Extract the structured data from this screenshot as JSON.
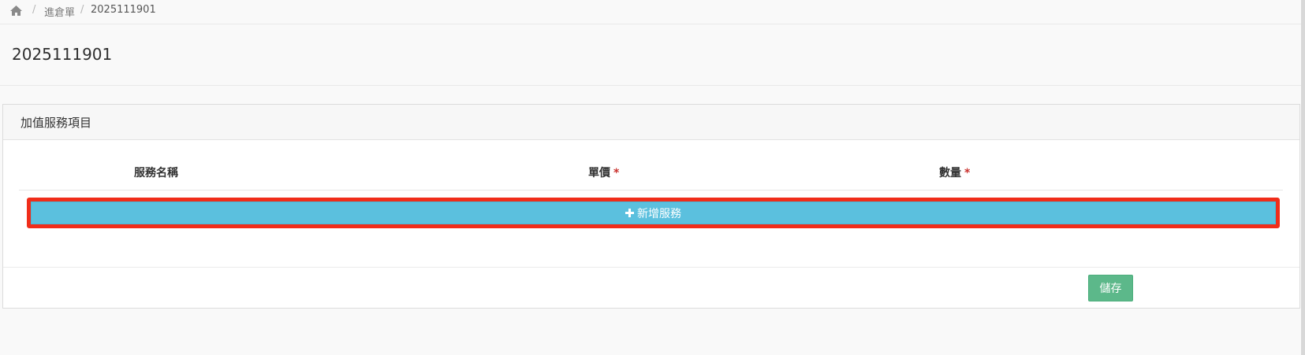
{
  "breadcrumb": {
    "home_icon": "home-icon",
    "separator": "/",
    "items": [
      "進倉單",
      "2025111901"
    ]
  },
  "page": {
    "title": "2025111901"
  },
  "panel": {
    "heading": "加值服務項目",
    "columns": [
      {
        "label": "服務名稱",
        "required": false
      },
      {
        "label": "單價",
        "required": true
      },
      {
        "label": "數量",
        "required": true
      }
    ],
    "required_mark": "*",
    "add_button_label": "新增服務",
    "add_button_icon": "plus-icon",
    "save_button_label": "儲存"
  },
  "colors": {
    "info_button": "#5bc0de",
    "success_button": "#5cb88a",
    "highlight_border": "#f02d1a",
    "required_mark": "#c9302c"
  }
}
